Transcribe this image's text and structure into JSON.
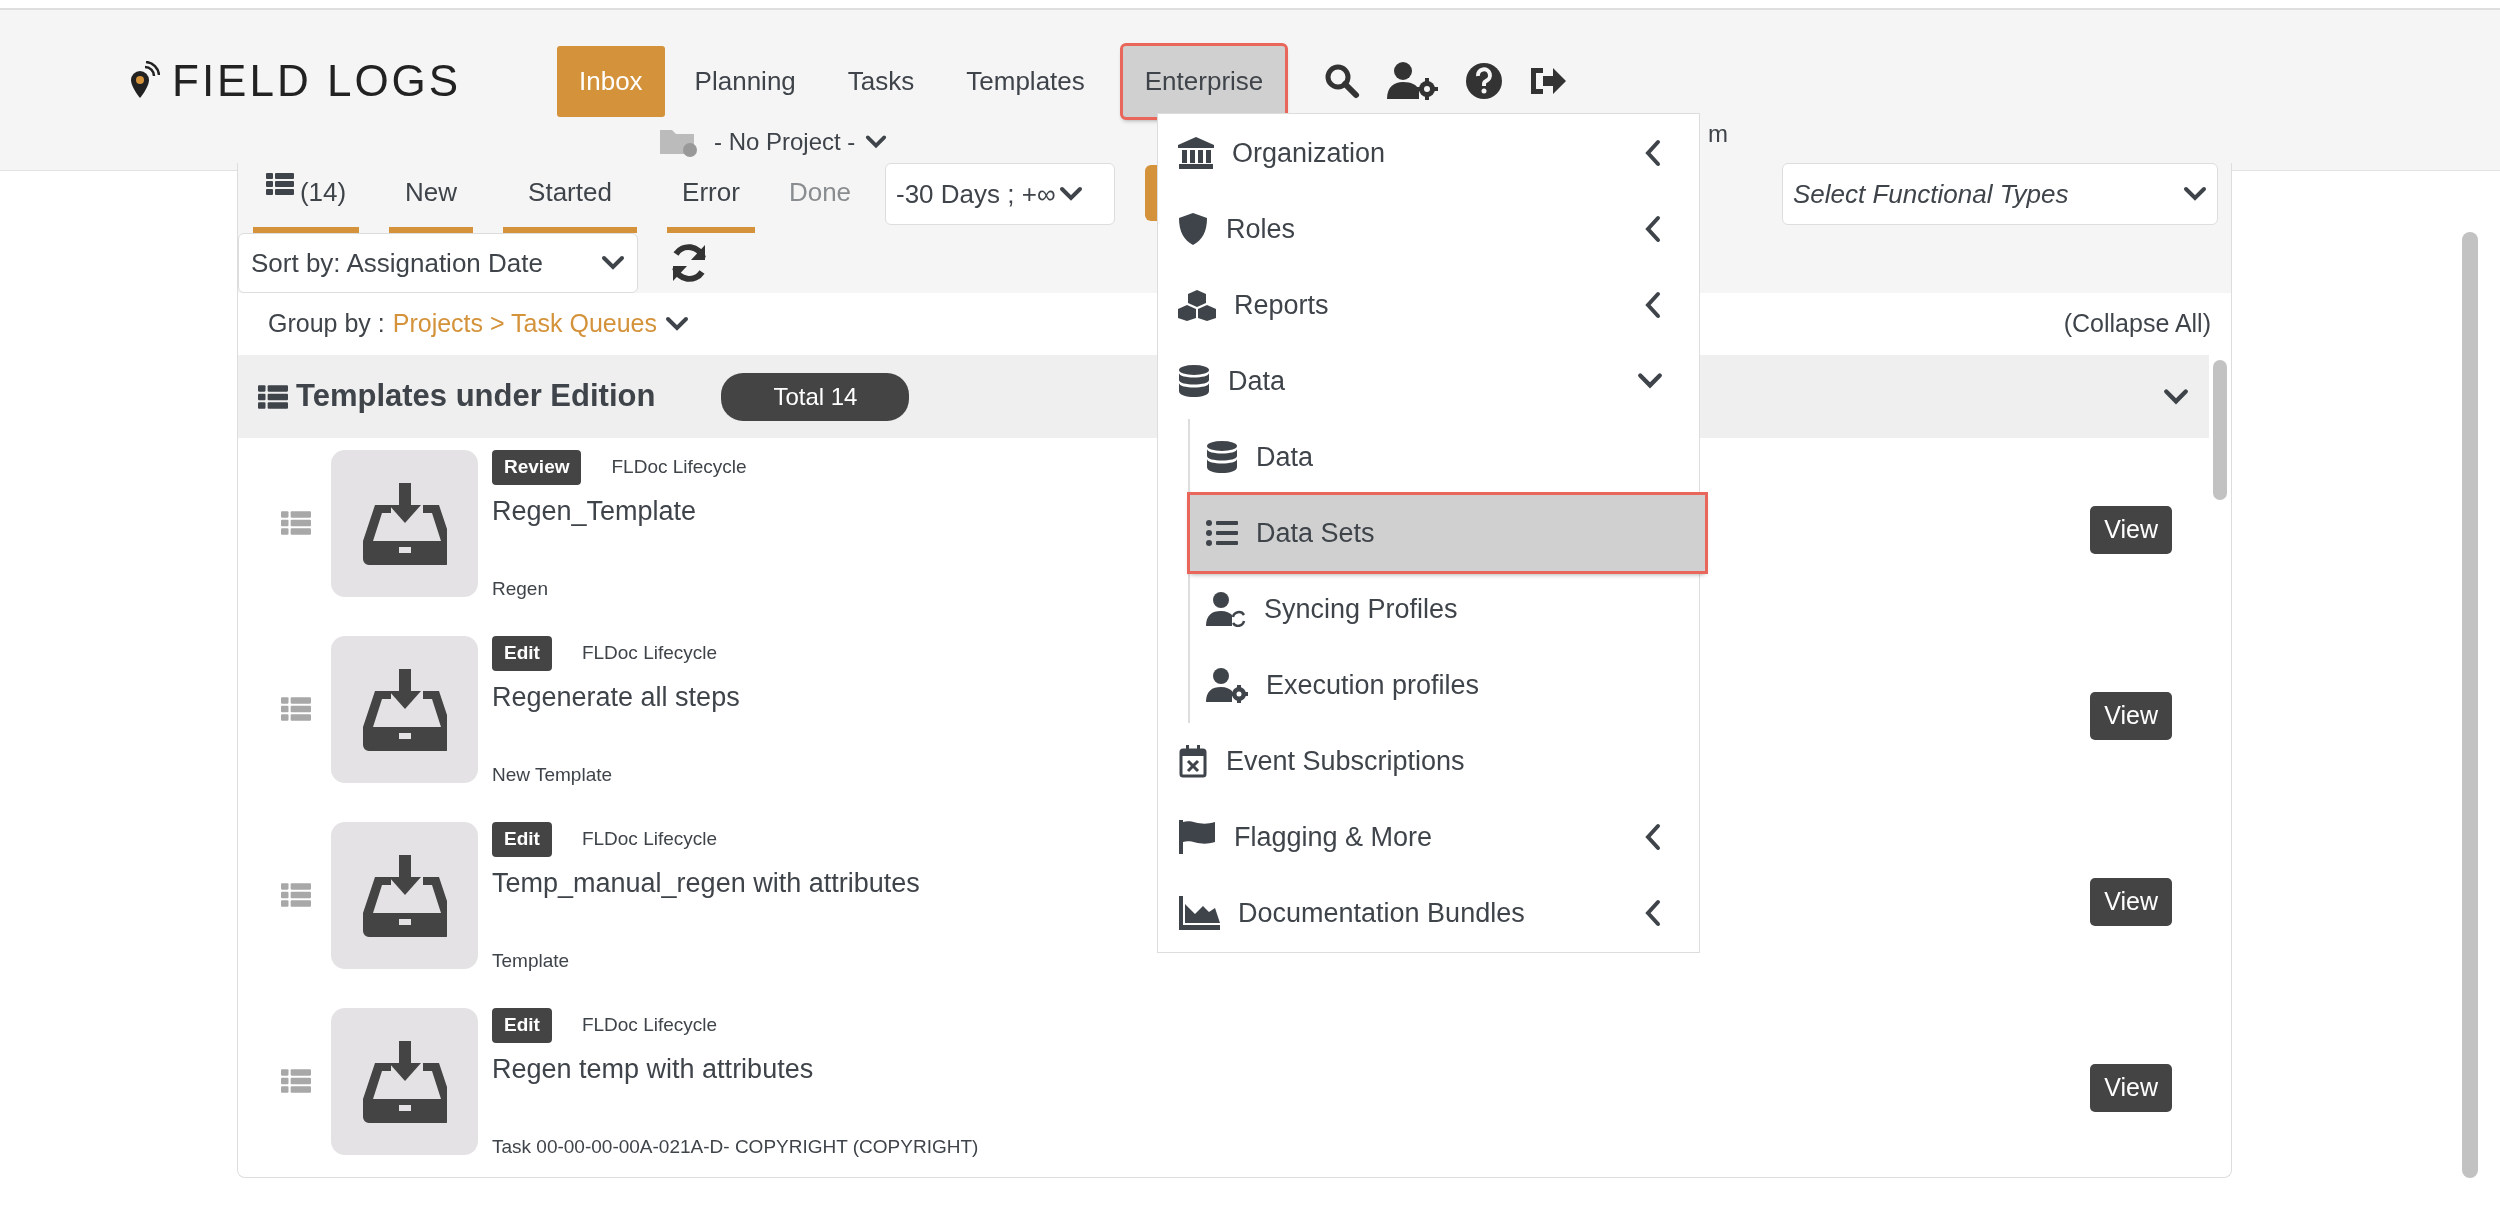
{
  "brand": {
    "name": "FIELD LOGS"
  },
  "nav": [
    {
      "label": "Inbox",
      "selected": true,
      "highlighted": false
    },
    {
      "label": "Planning",
      "selected": false,
      "highlighted": false
    },
    {
      "label": "Tasks",
      "selected": false,
      "highlighted": false
    },
    {
      "label": "Templates",
      "selected": false,
      "highlighted": false
    },
    {
      "label": "Enterprise",
      "selected": false,
      "highlighted": true
    }
  ],
  "project_selector": {
    "label": "- No Project -"
  },
  "partial_text": "m",
  "filter_tabs": [
    {
      "label": "(14)",
      "kind": "all",
      "selected": true
    },
    {
      "label": "New",
      "kind": "status",
      "selected": true
    },
    {
      "label": "Started",
      "kind": "status",
      "selected": true
    },
    {
      "label": "Error",
      "kind": "status",
      "selected": true
    },
    {
      "label": "Done",
      "kind": "status",
      "selected": false
    }
  ],
  "date_range": {
    "value": "-30 Days ; +∞"
  },
  "functional_types": {
    "placeholder": "Select Functional Types"
  },
  "sort": {
    "value": "Sort by: Assignation Date"
  },
  "group_by": {
    "label": "Group by :",
    "value": "Projects > Task Queues"
  },
  "collapse_all": "(Collapse All)",
  "group": {
    "title": "Templates under Edition",
    "total": "Total 14",
    "expanded": true
  },
  "items": [
    {
      "status": "Review",
      "lifecycle": "FLDoc Lifecycle",
      "title": "Regen_Template",
      "subtitle": "Regen",
      "action": "View"
    },
    {
      "status": "Edit",
      "lifecycle": "FLDoc Lifecycle",
      "title": "Regenerate all steps",
      "subtitle": "New Template",
      "action": "View"
    },
    {
      "status": "Edit",
      "lifecycle": "FLDoc Lifecycle",
      "title": "Temp_manual_regen with attributes",
      "subtitle": "Template",
      "action": "View"
    },
    {
      "status": "Edit",
      "lifecycle": "FLDoc Lifecycle",
      "title": "Regen temp with attributes",
      "subtitle": "Task 00-00-00-00A-021A-D- COPYRIGHT (COPYRIGHT)",
      "action": "View"
    }
  ],
  "menu": {
    "items": [
      {
        "label": "Organization",
        "kind": "submenu",
        "expanded": false
      },
      {
        "label": "Roles",
        "kind": "submenu",
        "expanded": false
      },
      {
        "label": "Reports",
        "kind": "submenu",
        "expanded": false
      },
      {
        "label": "Data",
        "kind": "submenu",
        "expanded": true,
        "children": [
          {
            "label": "Data",
            "selected": false
          },
          {
            "label": "Data Sets",
            "selected": true
          },
          {
            "label": "Syncing Profiles",
            "selected": false
          },
          {
            "label": "Execution profiles",
            "selected": false
          }
        ]
      },
      {
        "label": "Event Subscriptions",
        "kind": "link"
      },
      {
        "label": "Flagging & More",
        "kind": "submenu",
        "expanded": false
      },
      {
        "label": "Documentation Bundles",
        "kind": "submenu",
        "expanded": false
      }
    ]
  }
}
